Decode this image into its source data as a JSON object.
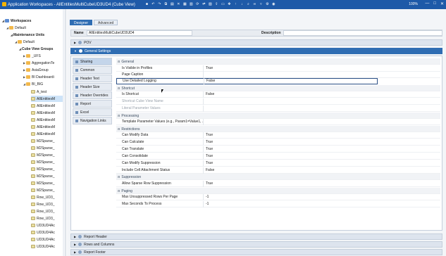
{
  "window": {
    "title": "Application Workspaces - AllEntitiesMultiCubeUD3UD4 (Cube View)",
    "zoom": "100%",
    "controls": [
      "—",
      "□",
      "✕"
    ]
  },
  "tree": {
    "items": [
      {
        "label": "Workspaces",
        "bold": true
      },
      {
        "label": "Default",
        "bold": false
      },
      {
        "label": "Maintenance Units",
        "bold": true
      },
      {
        "label": "Default",
        "bold": false
      },
      {
        "label": "Cube View Groups",
        "bold": true
      },
      {
        "label": "_UFS",
        "bold": false
      },
      {
        "label": "AggregationTe",
        "bold": false
      },
      {
        "label": "AsiaGroup",
        "bold": false
      },
      {
        "label": "BI Dashboardi",
        "bold": false
      },
      {
        "label": "BI_BIG",
        "bold": false
      },
      {
        "label": "A_test",
        "bold": false
      },
      {
        "label": "AllEntitiesM",
        "bold": false
      },
      {
        "label": "AllEntitiesM",
        "bold": false
      },
      {
        "label": "AllEntitiesM",
        "bold": false
      },
      {
        "label": "AllEntitiesM",
        "bold": false
      },
      {
        "label": "AllEntitiesM",
        "bold": false
      },
      {
        "label": "AllEntitiesM",
        "bold": false
      },
      {
        "label": "M2Sparse_",
        "bold": false
      },
      {
        "label": "M2Sparse_",
        "bold": false
      },
      {
        "label": "M2Sparse_",
        "bold": false
      },
      {
        "label": "M2Sparse_",
        "bold": false
      },
      {
        "label": "M2Sparse_",
        "bold": false
      },
      {
        "label": "M2Sparse_",
        "bold": false
      },
      {
        "label": "M2Sparse_",
        "bold": false
      },
      {
        "label": "M2Sparse_",
        "bold": false
      },
      {
        "label": "Row_UD3_",
        "bold": false
      },
      {
        "label": "Row_UD3_",
        "bold": false
      },
      {
        "label": "Row_UD3_",
        "bold": false
      },
      {
        "label": "Row_UD3_",
        "bold": false
      },
      {
        "label": "UD3UD4Ac",
        "bold": false
      },
      {
        "label": "UD3UD4Ac",
        "bold": false
      },
      {
        "label": "UD3UD4Ac",
        "bold": false
      },
      {
        "label": "UD3UD4Ac",
        "bold": false
      }
    ]
  },
  "tabs": [
    "Designer",
    "Advanced"
  ],
  "name_bar": {
    "name_label": "Name",
    "name_value": "AllEntitiesMultiCubeUD3UD4",
    "description_label": "Description",
    "description_value": ""
  },
  "sections": {
    "pov": "POV",
    "general_settings": "General Settings",
    "report_header": "Report Header",
    "rows_columns": "Rows and Columns",
    "report_footer": "Report Footer"
  },
  "nav": [
    "Sharing",
    "Common",
    "Header Text",
    "Header Size",
    "Header Overrides",
    "Report",
    "Excel",
    "Navigation Links"
  ],
  "props": {
    "general": "General",
    "visible_in_profiles": "Is Visible in Profiles",
    "visible_in_profiles_v": "True",
    "page_caption": "Page Caption",
    "page_caption_v": "",
    "detailed_logging": "Use Detailed Logging",
    "detailed_logging_v": "False",
    "shortcut": "Shortcut",
    "is_shortcut": "Is Shortcut",
    "is_shortcut_v": "False",
    "shortcut_name": "Shortcut Cube View Name",
    "shortcut_name_v": "",
    "literal_params": "Literal Parameter Values",
    "literal_params_v": "",
    "processing": "Processing",
    "template_params": "Template Parameter Values (e.g., Param1=Value1, ...)",
    "template_params_v": "",
    "restrictions": "Restrictions",
    "can_modify": "Can Modify Data",
    "can_modify_v": "True",
    "can_calc": "Can Calculate",
    "can_calc_v": "True",
    "can_translate": "Can Translate",
    "can_translate_v": "True",
    "can_consolidate": "Can Consolidate",
    "can_consolidate_v": "True",
    "can_mod_supp": "Can Modify Suppression",
    "can_mod_supp_v": "True",
    "cell_attach": "Include Cell Attachment Status",
    "cell_attach_v": "False",
    "suppression": "Suppression",
    "sparse_row": "Allow Sparse Row Suppression",
    "sparse_row_v": "True",
    "paging": "Paging",
    "max_unsupp": "Max Unsuppressed Rows Per Page",
    "max_unsupp_v": "-1",
    "max_secs": "Max Seconds To Process",
    "max_secs_v": "-1"
  }
}
